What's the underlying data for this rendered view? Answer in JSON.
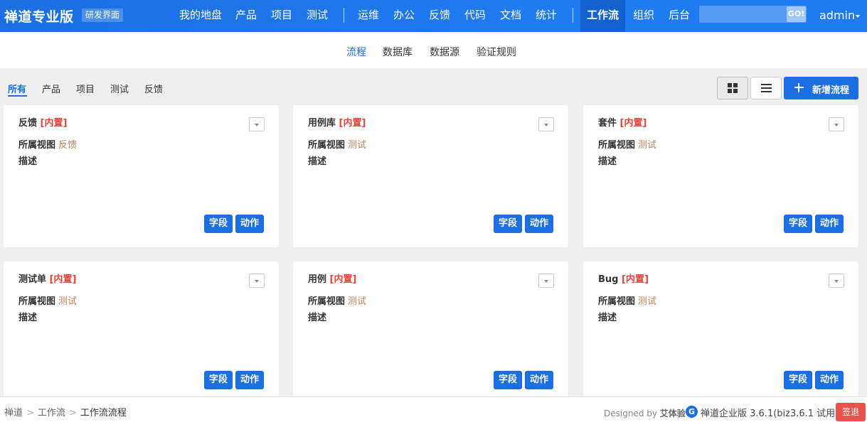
{
  "header": {
    "brand": "禅道专业版",
    "badge": "研发界面",
    "nav": [
      "我的地盘",
      "产品",
      "项目",
      "测试",
      "运维",
      "办公",
      "反馈",
      "代码",
      "文档",
      "统计",
      "工作流",
      "组织",
      "后台"
    ],
    "active_nav": "工作流",
    "search_placeholder": "",
    "search_button": "GO!",
    "user": "admin"
  },
  "subnav": {
    "items": [
      "流程",
      "数据库",
      "数据源",
      "验证规则"
    ],
    "active": "流程"
  },
  "filters": {
    "tabs": [
      "所有",
      "产品",
      "项目",
      "测试",
      "反馈"
    ],
    "active": "所有",
    "add_button": "新增流程"
  },
  "cards": [
    {
      "name": "反馈",
      "tag": "[内置]",
      "view_label": "所属视图",
      "view": "反馈",
      "desc_label": "描述",
      "fields_btn": "字段",
      "actions_btn": "动作"
    },
    {
      "name": "用例库",
      "tag": "[内置]",
      "view_label": "所属视图",
      "view": "测试",
      "desc_label": "描述",
      "fields_btn": "字段",
      "actions_btn": "动作"
    },
    {
      "name": "套件",
      "tag": "[内置]",
      "view_label": "所属视图",
      "view": "测试",
      "desc_label": "描述",
      "fields_btn": "字段",
      "actions_btn": "动作"
    },
    {
      "name": "测试单",
      "tag": "[内置]",
      "view_label": "所属视图",
      "view": "测试",
      "desc_label": "描述",
      "fields_btn": "字段",
      "actions_btn": "动作"
    },
    {
      "name": "用例",
      "tag": "[内置]",
      "view_label": "所属视图",
      "view": "测试",
      "desc_label": "描述",
      "fields_btn": "字段",
      "actions_btn": "动作"
    },
    {
      "name": "Bug",
      "tag": "[内置]",
      "view_label": "所属视图",
      "view": "测试",
      "desc_label": "描述",
      "fields_btn": "字段",
      "actions_btn": "动作"
    }
  ],
  "footer": {
    "breadcrumb": [
      "禅道",
      "工作流",
      "工作流流程"
    ],
    "designed_prefix": "Designed by",
    "designed_by": "艾体验",
    "logo_glyph": "G",
    "version": "禅道企业版 3.6.1(biz3.6.1 试用)",
    "logout": "签退"
  },
  "colors": {
    "primary": "#1c6fe0",
    "builtin_tag": "#e0443b",
    "view_value": "#b8835a",
    "logout": "#e9534b"
  }
}
